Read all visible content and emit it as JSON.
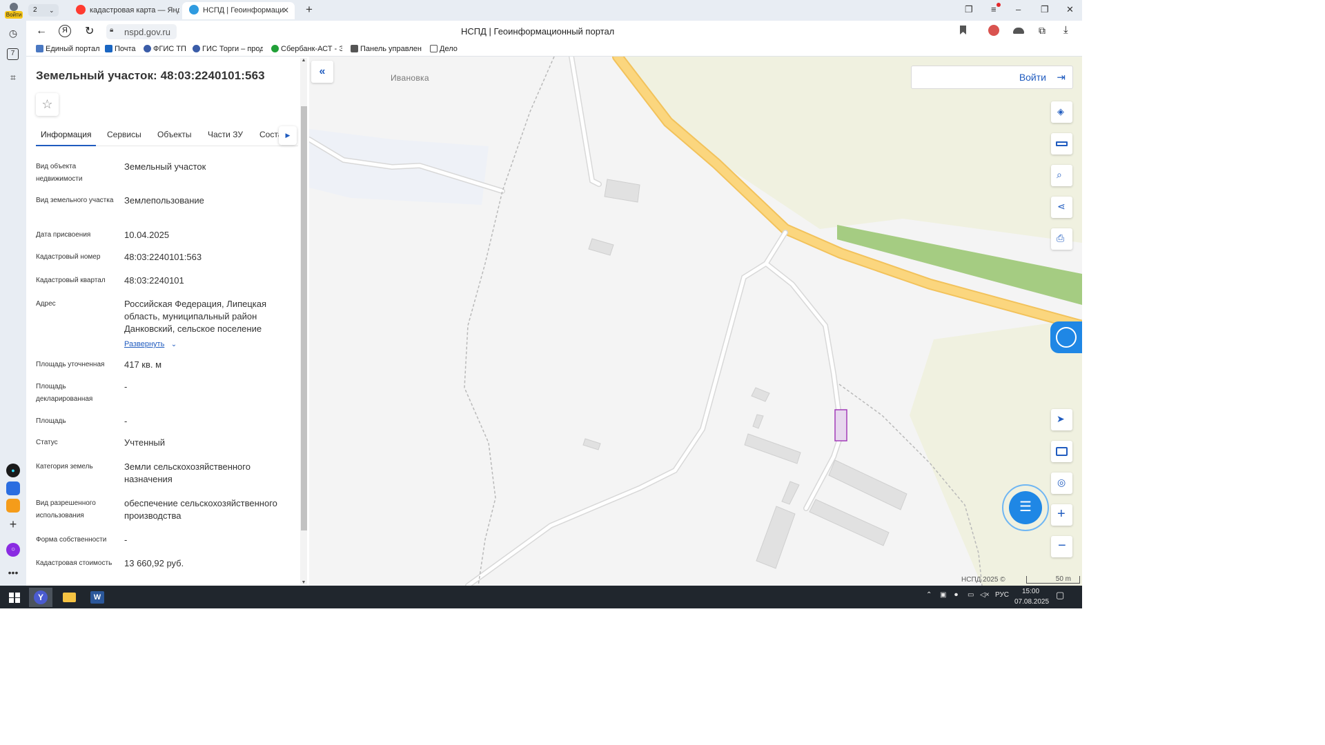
{
  "browser": {
    "profile_label": "Войти",
    "tab_count": "2",
    "tabs": [
      {
        "title": "кадастровая карта — Янд"
      },
      {
        "title": "НСПД | Геоинформаци"
      }
    ],
    "url": "nspd.gov.ru",
    "page_title": "НСПД | Геоинформационный портал",
    "bookmarks": [
      {
        "label": "Единый портал"
      },
      {
        "label": "Почта"
      },
      {
        "label": "ФГИС ТП"
      },
      {
        "label": "ГИС Торги – прод"
      },
      {
        "label": "Сбербанк-АСТ - Э"
      },
      {
        "label": "Панель управлени"
      },
      {
        "label": "Дело"
      }
    ],
    "sidebar_badge": "7"
  },
  "panel": {
    "title": "Земельный участок: 48:03:2240101:563",
    "tabs": [
      {
        "label": "Информация"
      },
      {
        "label": "Сервисы"
      },
      {
        "label": "Объекты"
      },
      {
        "label": "Части ЗУ"
      },
      {
        "label": "Соста"
      }
    ],
    "fields": [
      {
        "label": "Вид объекта недвижимости",
        "value": "Земельный участок"
      },
      {
        "label": "Вид земельного участка",
        "value": "Землепользование"
      },
      {
        "label": "Дата присвоения",
        "value": "10.04.2025"
      },
      {
        "label": "Кадастровый номер",
        "value": "48:03:2240101:563"
      },
      {
        "label": "Кадастровый квартал",
        "value": "48:03:2240101"
      },
      {
        "label": "Адрес",
        "value": "Российская Федерация, Липецкая область, муниципальный район Данковский, сельское поселение"
      },
      {
        "label": "Площадь уточненная",
        "value": "417 кв. м"
      },
      {
        "label": "Площадь декларированная",
        "value": "-"
      },
      {
        "label": "Площадь",
        "value": "-"
      },
      {
        "label": "Статус",
        "value": "Учтенный"
      },
      {
        "label": "Категория земель",
        "value": "Земли сельскохозяйственного назначения"
      },
      {
        "label": "Вид разрешенного использования",
        "value": "обеспечение сельскохозяйственного производства"
      },
      {
        "label": "Форма собственности",
        "value": "-"
      },
      {
        "label": "Кадастровая стоимость",
        "value": "13 660,92 руб."
      }
    ],
    "expand_label": "Развернуть"
  },
  "map": {
    "login_label": "Войти",
    "place_label": "Ивановка",
    "copyright": "НСПД 2025 ©",
    "scale_label": "50 m",
    "colors": {
      "road_major": "#fbd67e",
      "road_major_edge": "#f2c25b",
      "field_green": "#a5cc82",
      "field_beige": "#f0f1e0",
      "parcel_outline": "#a23bb8",
      "accent": "#1f5bbf"
    }
  },
  "taskbar": {
    "lang": "РУС",
    "time": "15:00",
    "date": "07.08.2025"
  }
}
